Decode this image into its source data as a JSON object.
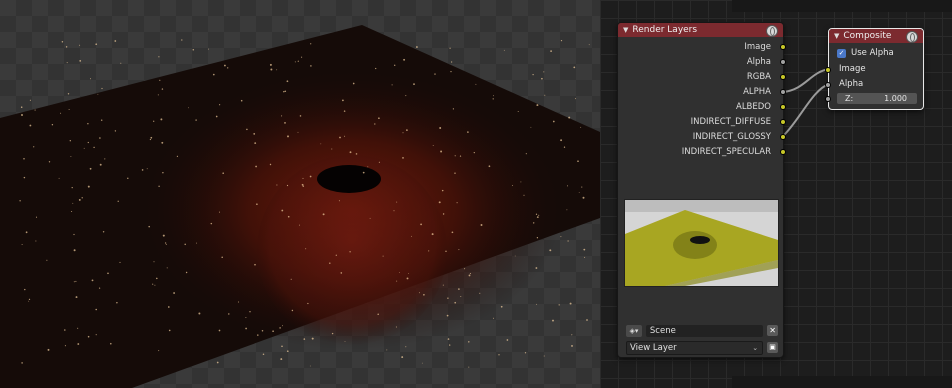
{
  "render_layers_node": {
    "title": "Render Layers",
    "outputs": [
      {
        "label": "Image",
        "socket": "yellow"
      },
      {
        "label": "Alpha",
        "socket": "grey"
      },
      {
        "label": "RGBA",
        "socket": "yellow"
      },
      {
        "label": "ALPHA",
        "socket": "grey"
      },
      {
        "label": "ALBEDO",
        "socket": "yellow"
      },
      {
        "label": "INDIRECT_DIFFUSE",
        "socket": "yellow"
      },
      {
        "label": "INDIRECT_GLOSSY",
        "socket": "yellow"
      },
      {
        "label": "INDIRECT_SPECULAR",
        "socket": "yellow"
      }
    ],
    "scene_label": "Scene",
    "view_layer_label": "View Layer"
  },
  "composite_node": {
    "title": "Composite",
    "use_alpha_label": "Use Alpha",
    "use_alpha_checked": true,
    "inputs": [
      "Image",
      "Alpha"
    ],
    "z_label": "Z:",
    "z_value": "1.000"
  },
  "colors": {
    "node_header": "#7c2a2f",
    "socket_color": "#c7c729",
    "socket_grey": "#a1a1a1",
    "checkbox_accent": "#4a78c8"
  },
  "icons": {
    "node_header": "globe-icon",
    "scene": "scene-icon",
    "scene_clear": "close-icon",
    "view_layer_browse": "view-layer-icon",
    "checkbox": "check-icon"
  }
}
